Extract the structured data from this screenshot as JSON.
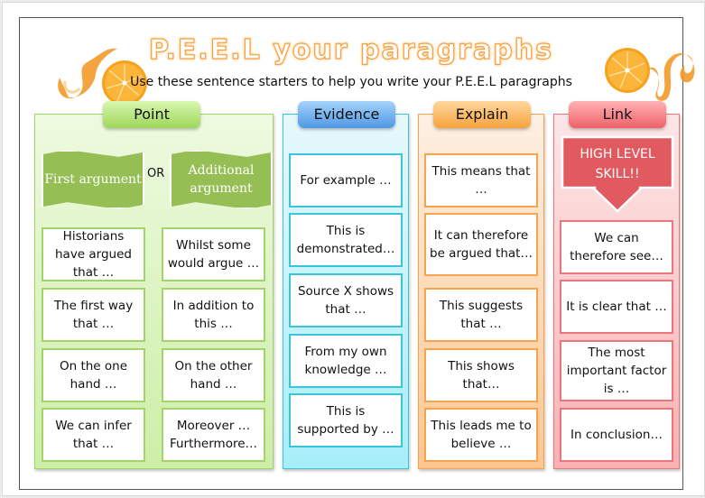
{
  "header": {
    "title": "P.E.E.L your paragraphs",
    "subtitle": "Use these sentence starters to help you write your P.E.E.L paragraphs"
  },
  "columns": {
    "point": {
      "label": "Point",
      "banners": [
        "First argument",
        "Additional argument"
      ],
      "connector": "OR",
      "cards": [
        "Historians have argued that …",
        "Whilst some would argue …",
        "The first way that …",
        "In addition to this …",
        "On the one hand …",
        "On the other hand …",
        "We can infer that …",
        "Moreover … Furthermore…"
      ]
    },
    "evidence": {
      "label": "Evidence",
      "cards": [
        "For example …",
        "This is demonstrated…",
        "Source X shows that …",
        "From my own knowledge …",
        "This is supported by …"
      ]
    },
    "explain": {
      "label": "Explain",
      "cards": [
        "This means that …",
        "It can therefore be argued that…",
        "This suggests that …",
        "This shows that…",
        "This leads me to believe …"
      ]
    },
    "link": {
      "label": "Link",
      "callout": "HIGH LEVEL SKILL!!",
      "cards": [
        "We can therefore see…",
        "It is clear that …",
        "The most important factor is …",
        "In conclusion…"
      ]
    }
  },
  "colors": {
    "point": "#9ed65b",
    "evidence": "#4f98e4",
    "explain": "#f6a33c",
    "link": "#ee6167",
    "title_outline": "#f5a141"
  }
}
